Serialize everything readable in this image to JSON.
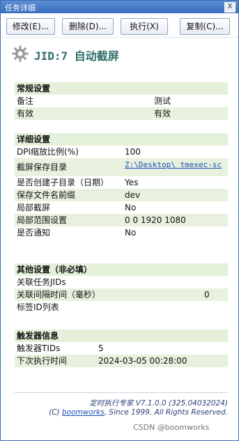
{
  "window": {
    "title": "任务详细",
    "close_glyph": "X"
  },
  "toolbar": {
    "modify_label": "修改(E)...",
    "delete_label": "删除(D)...",
    "execute_label": "执行(X)",
    "copy_label": "复制(C)..."
  },
  "header": {
    "jid_text": "JID:7  自动截屏"
  },
  "sections": {
    "general": {
      "title": "常规设置",
      "rows": [
        {
          "key": "备注",
          "value": "测试"
        },
        {
          "key": "有效",
          "value": "有效"
        }
      ]
    },
    "detail": {
      "title": "详细设置",
      "rows": [
        {
          "key": "DPI缩放比例(%)",
          "value": "100"
        },
        {
          "key": "截屏保存目录",
          "value": "Z:\\Desktop\\ tmexec-sc"
        },
        {
          "key": "是否创建子目录（日期）",
          "value": "Yes"
        },
        {
          "key": "保存文件名前缀",
          "value": "dev"
        },
        {
          "key": "局部截屏",
          "value": "No"
        },
        {
          "key": "局部范围设置",
          "value": "0 0 1920 1080"
        },
        {
          "key": "是否通知",
          "value": "No"
        }
      ]
    },
    "other": {
      "title": "其他设置（非必填）",
      "rows": [
        {
          "key": "关联任务JIDs",
          "value": ""
        },
        {
          "key": "关联间隔时间（毫秒）",
          "value": "0"
        },
        {
          "key": "标签ID列表",
          "value": ""
        }
      ]
    },
    "trigger": {
      "title": "触发器信息",
      "rows": [
        {
          "key": "触发器TIDs",
          "value": "5"
        },
        {
          "key": "下次执行时间",
          "value": "2024-03-05 00:28:00"
        }
      ]
    }
  },
  "footer": {
    "version_line": "定时执行专家 V7.1.0.0 (325.04032024)",
    "copyright_prefix": "(C)",
    "company": "boomworks",
    "copyright_suffix": ", Since 1999. All Rights Reserved."
  },
  "watermark": "CSDN @boomworks",
  "colors": {
    "accent": "#2f6e6b",
    "section_bg": "#e4f0d9",
    "link": "#1a4fb8",
    "titlebar": "#3a6dbf"
  }
}
